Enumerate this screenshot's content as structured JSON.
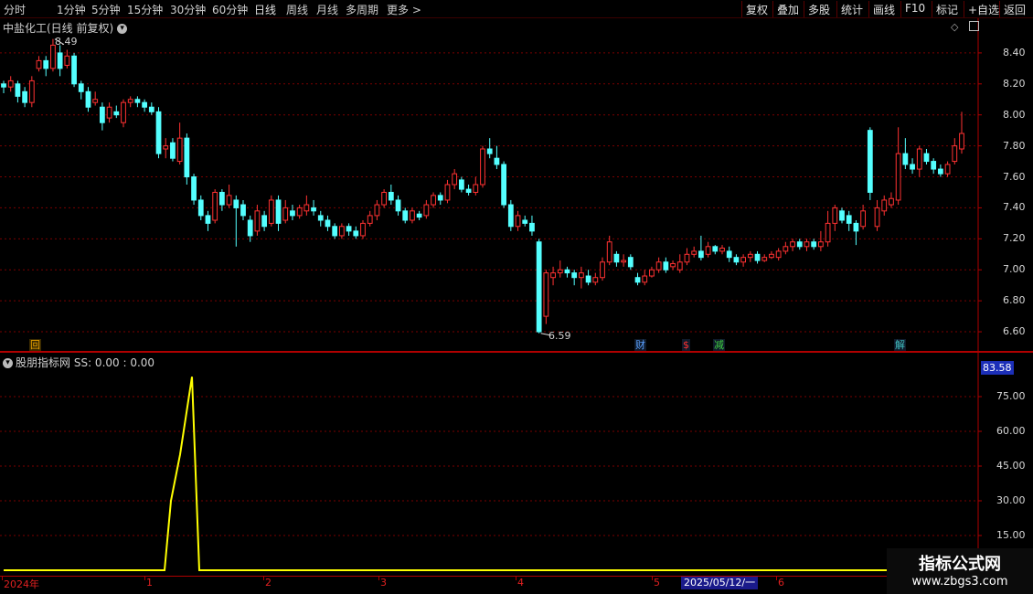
{
  "toolbar": {
    "periods": [
      "分时",
      "1分钟",
      "5分钟",
      "15分钟",
      "30分钟",
      "60分钟",
      "日线",
      "周线",
      "月线",
      "多周期",
      "更多 >"
    ],
    "active_period": "日线",
    "buttons": [
      "复权",
      "叠加",
      "多股",
      "统计",
      "画线",
      "F10",
      "标记",
      "+自选",
      "返回"
    ]
  },
  "main_chart": {
    "title": "中盐化工(日线 前复权)",
    "high_label": "8.49",
    "low_label": "6.59",
    "y_ticks": [
      "8.40",
      "8.20",
      "8.00",
      "7.80",
      "7.60",
      "7.40",
      "7.20",
      "7.00",
      "6.80",
      "6.60"
    ],
    "events": [
      {
        "label": "回",
        "color": "#e8a000"
      },
      {
        "label": "财",
        "color": "#5aa0ff"
      },
      {
        "label": "$",
        "color": "#ff3030"
      },
      {
        "label": "减",
        "color": "#40d040"
      },
      {
        "label": "解",
        "color": "#40c0c0"
      }
    ]
  },
  "sub_chart": {
    "title": "股朋指标网",
    "formula": "SS: 0.00 : 0.00",
    "y_ticks": [
      "75.00",
      "60.00",
      "45.00",
      "30.00",
      "15.00"
    ],
    "current_value": "83.58"
  },
  "time_axis": {
    "labels": [
      "2024年",
      "1",
      "2",
      "3",
      "4",
      "5",
      "6"
    ],
    "cursor_date": "2025/05/12/一"
  },
  "watermark": {
    "line1": "指标公式网",
    "line2": "www.zbgs3.com"
  },
  "colors": {
    "up": "#ff3232",
    "down": "#54ffff",
    "indicator": "#ffff00",
    "grid": "#7a0000"
  },
  "chart_data": [
    {
      "type": "candlestick",
      "title": "中盐化工(日线 前复权)",
      "ylim": [
        6.5,
        8.6
      ],
      "candles": [
        [
          8.2,
          8.18,
          8.22,
          8.14
        ],
        [
          8.18,
          8.22,
          8.25,
          8.15
        ],
        [
          8.2,
          8.12,
          8.22,
          8.08
        ],
        [
          8.15,
          8.08,
          8.18,
          8.05
        ],
        [
          8.08,
          8.22,
          8.25,
          8.05
        ],
        [
          8.3,
          8.35,
          8.38,
          8.28
        ],
        [
          8.35,
          8.3,
          8.38,
          8.25
        ],
        [
          8.3,
          8.45,
          8.49,
          8.28
        ],
        [
          8.4,
          8.3,
          8.45,
          8.25
        ],
        [
          8.32,
          8.38,
          8.42,
          8.3
        ],
        [
          8.38,
          8.2,
          8.4,
          8.18
        ],
        [
          8.2,
          8.15,
          8.22,
          8.1
        ],
        [
          8.15,
          8.05,
          8.18,
          8.02
        ],
        [
          8.08,
          8.1,
          8.15,
          8.06
        ],
        [
          8.05,
          7.95,
          8.08,
          7.9
        ],
        [
          7.98,
          8.05,
          8.08,
          7.95
        ],
        [
          8.02,
          8.0,
          8.06,
          7.98
        ],
        [
          7.95,
          8.08,
          8.1,
          7.92
        ],
        [
          8.08,
          8.1,
          8.12,
          8.05
        ],
        [
          8.1,
          8.08,
          8.12,
          8.05
        ],
        [
          8.08,
          8.05,
          8.1,
          8.02
        ],
        [
          8.05,
          8.02,
          8.08,
          8.0
        ],
        [
          8.02,
          7.75,
          8.05,
          7.72
        ],
        [
          7.78,
          7.8,
          7.85,
          7.72
        ],
        [
          7.82,
          7.72,
          7.85,
          7.7
        ],
        [
          7.7,
          7.85,
          7.95,
          7.68
        ],
        [
          7.85,
          7.6,
          7.88,
          7.55
        ],
        [
          7.6,
          7.45,
          7.62,
          7.42
        ],
        [
          7.45,
          7.35,
          7.48,
          7.32
        ],
        [
          7.35,
          7.3,
          7.38,
          7.25
        ],
        [
          7.32,
          7.5,
          7.52,
          7.3
        ],
        [
          7.5,
          7.42,
          7.52,
          7.38
        ],
        [
          7.42,
          7.48,
          7.55,
          7.4
        ],
        [
          7.45,
          7.4,
          7.48,
          7.15
        ],
        [
          7.42,
          7.35,
          7.45,
          7.32
        ],
        [
          7.32,
          7.22,
          7.35,
          7.18
        ],
        [
          7.25,
          7.38,
          7.42,
          7.22
        ],
        [
          7.35,
          7.28,
          7.38,
          7.25
        ],
        [
          7.3,
          7.45,
          7.48,
          7.28
        ],
        [
          7.45,
          7.3,
          7.48,
          7.25
        ],
        [
          7.32,
          7.4,
          7.45,
          7.3
        ],
        [
          7.38,
          7.35,
          7.42,
          7.32
        ],
        [
          7.35,
          7.4,
          7.42,
          7.33
        ],
        [
          7.38,
          7.42,
          7.48,
          7.35
        ],
        [
          7.4,
          7.38,
          7.45,
          7.35
        ],
        [
          7.35,
          7.32,
          7.38,
          7.28
        ],
        [
          7.32,
          7.28,
          7.35,
          7.25
        ],
        [
          7.28,
          7.22,
          7.3,
          7.2
        ],
        [
          7.22,
          7.28,
          7.3,
          7.2
        ],
        [
          7.28,
          7.25,
          7.3,
          7.22
        ],
        [
          7.25,
          7.22,
          7.28,
          7.2
        ],
        [
          7.22,
          7.3,
          7.32,
          7.2
        ],
        [
          7.3,
          7.35,
          7.38,
          7.28
        ],
        [
          7.35,
          7.42,
          7.45,
          7.32
        ],
        [
          7.42,
          7.5,
          7.52,
          7.4
        ],
        [
          7.5,
          7.45,
          7.55,
          7.42
        ],
        [
          7.45,
          7.38,
          7.48,
          7.35
        ],
        [
          7.38,
          7.32,
          7.4,
          7.3
        ],
        [
          7.32,
          7.38,
          7.4,
          7.3
        ],
        [
          7.36,
          7.34,
          7.38,
          7.32
        ],
        [
          7.35,
          7.42,
          7.45,
          7.33
        ],
        [
          7.42,
          7.48,
          7.5,
          7.4
        ],
        [
          7.48,
          7.45,
          7.5,
          7.42
        ],
        [
          7.45,
          7.55,
          7.58,
          7.43
        ],
        [
          7.55,
          7.62,
          7.65,
          7.52
        ],
        [
          7.58,
          7.52,
          7.6,
          7.5
        ],
        [
          7.52,
          7.5,
          7.55,
          7.48
        ],
        [
          7.5,
          7.55,
          7.6,
          7.48
        ],
        [
          7.55,
          7.78,
          7.8,
          7.53
        ],
        [
          7.78,
          7.75,
          7.85,
          7.72
        ],
        [
          7.72,
          7.68,
          7.8,
          7.65
        ],
        [
          7.68,
          7.42,
          7.7,
          7.4
        ],
        [
          7.42,
          7.28,
          7.45,
          7.25
        ],
        [
          7.28,
          7.35,
          7.38,
          7.25
        ],
        [
          7.32,
          7.3,
          7.35,
          7.28
        ],
        [
          7.3,
          7.25,
          7.35,
          7.22
        ],
        [
          7.18,
          6.6,
          7.2,
          6.59
        ],
        [
          6.7,
          6.98,
          7.0,
          6.65
        ],
        [
          6.95,
          6.98,
          7.02,
          6.9
        ],
        [
          6.98,
          7.0,
          7.06,
          6.95
        ],
        [
          7.0,
          6.98,
          7.02,
          6.95
        ],
        [
          6.98,
          6.95,
          7.0,
          6.9
        ],
        [
          6.95,
          6.98,
          7.02,
          6.88
        ],
        [
          6.96,
          6.92,
          7.0,
          6.9
        ],
        [
          6.92,
          6.95,
          6.98,
          6.9
        ],
        [
          6.95,
          7.05,
          7.08,
          6.93
        ],
        [
          7.05,
          7.18,
          7.22,
          7.03
        ],
        [
          7.1,
          7.05,
          7.12,
          7.02
        ],
        [
          7.05,
          7.06,
          7.1,
          7.02
        ],
        [
          7.08,
          7.02,
          7.1,
          7.0
        ],
        [
          6.95,
          6.92,
          6.98,
          6.9
        ],
        [
          6.92,
          6.96,
          7.0,
          6.9
        ],
        [
          6.96,
          7.0,
          7.02,
          6.95
        ],
        [
          7.0,
          7.05,
          7.08,
          6.98
        ],
        [
          7.05,
          7.0,
          7.08,
          6.98
        ],
        [
          7.02,
          7.04,
          7.06,
          7.0
        ],
        [
          7.0,
          7.05,
          7.1,
          6.98
        ],
        [
          7.05,
          7.1,
          7.14,
          7.03
        ],
        [
          7.1,
          7.12,
          7.15,
          7.08
        ],
        [
          7.12,
          7.08,
          7.22,
          7.06
        ],
        [
          7.1,
          7.15,
          7.18,
          7.08
        ],
        [
          7.15,
          7.12,
          7.16,
          7.1
        ],
        [
          7.12,
          7.14,
          7.16,
          7.1
        ],
        [
          7.12,
          7.08,
          7.15,
          7.05
        ],
        [
          7.08,
          7.05,
          7.1,
          7.03
        ],
        [
          7.05,
          7.08,
          7.1,
          7.02
        ],
        [
          7.08,
          7.1,
          7.12,
          7.05
        ],
        [
          7.1,
          7.06,
          7.12,
          7.04
        ],
        [
          7.06,
          7.08,
          7.1,
          7.05
        ],
        [
          7.08,
          7.1,
          7.12,
          7.07
        ],
        [
          7.08,
          7.12,
          7.14,
          7.06
        ],
        [
          7.12,
          7.15,
          7.18,
          7.1
        ],
        [
          7.15,
          7.18,
          7.2,
          7.12
        ],
        [
          7.18,
          7.15,
          7.2,
          7.13
        ],
        [
          7.15,
          7.18,
          7.2,
          7.12
        ],
        [
          7.18,
          7.15,
          7.2,
          7.13
        ],
        [
          7.15,
          7.18,
          7.25,
          7.12
        ],
        [
          7.18,
          7.3,
          7.38,
          7.15
        ],
        [
          7.3,
          7.4,
          7.42,
          7.25
        ],
        [
          7.38,
          7.32,
          7.4,
          7.3
        ],
        [
          7.35,
          7.3,
          7.38,
          7.25
        ],
        [
          7.3,
          7.25,
          7.32,
          7.16
        ],
        [
          7.28,
          7.38,
          7.42,
          7.26
        ],
        [
          7.9,
          7.5,
          7.92,
          7.45
        ],
        [
          7.28,
          7.4,
          7.45,
          7.25
        ],
        [
          7.38,
          7.45,
          7.48,
          7.35
        ],
        [
          7.42,
          7.46,
          7.5,
          7.4
        ],
        [
          7.45,
          7.75,
          7.92,
          7.42
        ],
        [
          7.75,
          7.68,
          7.85,
          7.65
        ],
        [
          7.68,
          7.65,
          7.72,
          7.62
        ],
        [
          7.65,
          7.78,
          7.8,
          7.6
        ],
        [
          7.75,
          7.7,
          7.78,
          7.68
        ],
        [
          7.7,
          7.65,
          7.72,
          7.62
        ],
        [
          7.65,
          7.62,
          7.68,
          7.6
        ],
        [
          7.62,
          7.68,
          7.7,
          7.6
        ],
        [
          7.7,
          7.8,
          7.85,
          7.68
        ],
        [
          7.78,
          7.88,
          8.02,
          7.75
        ]
      ]
    },
    {
      "type": "line",
      "title": "股朋指标网",
      "ylim": [
        0,
        90
      ],
      "series": [
        {
          "name": "SS",
          "values": [
            0,
            0,
            0,
            0,
            0,
            0,
            0,
            0,
            0,
            0,
            0,
            0,
            0,
            0,
            0,
            0,
            0,
            0,
            0,
            0,
            0,
            0,
            0,
            0,
            0,
            0,
            0,
            0,
            0,
            0,
            0,
            0,
            0,
            0,
            0,
            0,
            0,
            0,
            0,
            0,
            0,
            0,
            0,
            0,
            0,
            0,
            0,
            0,
            0,
            0,
            0,
            0,
            0,
            0,
            0,
            0,
            0,
            0,
            0,
            0,
            0,
            0,
            0,
            0,
            0,
            0,
            0,
            0,
            0,
            0,
            0,
            0,
            0,
            0,
            0,
            0,
            0,
            0,
            0,
            0,
            0,
            0,
            0,
            0,
            0,
            0,
            0,
            0,
            0,
            0,
            0,
            0,
            0,
            0,
            0,
            0,
            0,
            0,
            0,
            0,
            0,
            0,
            0,
            0,
            0,
            0,
            0,
            0,
            0,
            0,
            0,
            0,
            0,
            0,
            0,
            0,
            0,
            0,
            0,
            0,
            0,
            0,
            0,
            0,
            0,
            0,
            0,
            0,
            0,
            0,
            0,
            0,
            0,
            0,
            0,
            0,
            0,
            0,
            0,
            0,
            0,
            0,
            0,
            0,
            0,
            0,
            0,
            0,
            0,
            0,
            0,
            0,
            0,
            0,
            0,
            0,
            0,
            0,
            0,
            0
          ],
          "spike": [
            [
              180,
              0
            ],
            [
              187,
              30
            ],
            [
              197,
              50
            ],
            [
              210,
              83.58
            ],
            [
              218,
              0
            ]
          ]
        }
      ]
    }
  ]
}
